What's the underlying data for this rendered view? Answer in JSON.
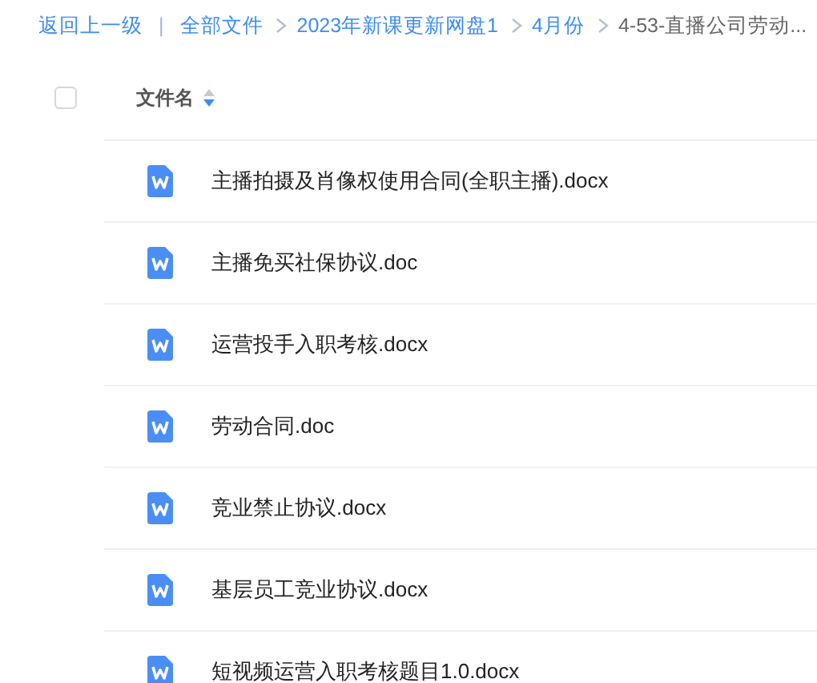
{
  "breadcrumb": {
    "back": "返回上一级",
    "separator": "|",
    "items": [
      {
        "label": "全部文件",
        "current": false
      },
      {
        "label": "2023年新课更新网盘1",
        "current": false
      },
      {
        "label": "4月份",
        "current": false
      },
      {
        "label": "4-53-直播公司劳动...",
        "current": true
      }
    ]
  },
  "header": {
    "select_all": {
      "checked": false
    },
    "column": "文件名"
  },
  "files": [
    {
      "name": "主播拍摄及肖像权使用合同(全职主播).docx",
      "kind": "word"
    },
    {
      "name": "主播免买社保协议.doc",
      "kind": "word"
    },
    {
      "name": "运营投手入职考核.docx",
      "kind": "word"
    },
    {
      "name": "劳动合同.doc",
      "kind": "word"
    },
    {
      "name": "竞业禁止协议.docx",
      "kind": "word"
    },
    {
      "name": "基层员工竞业协议.docx",
      "kind": "word"
    },
    {
      "name": "短视频运营入职考核题目1.0.docx",
      "kind": "word"
    }
  ]
}
